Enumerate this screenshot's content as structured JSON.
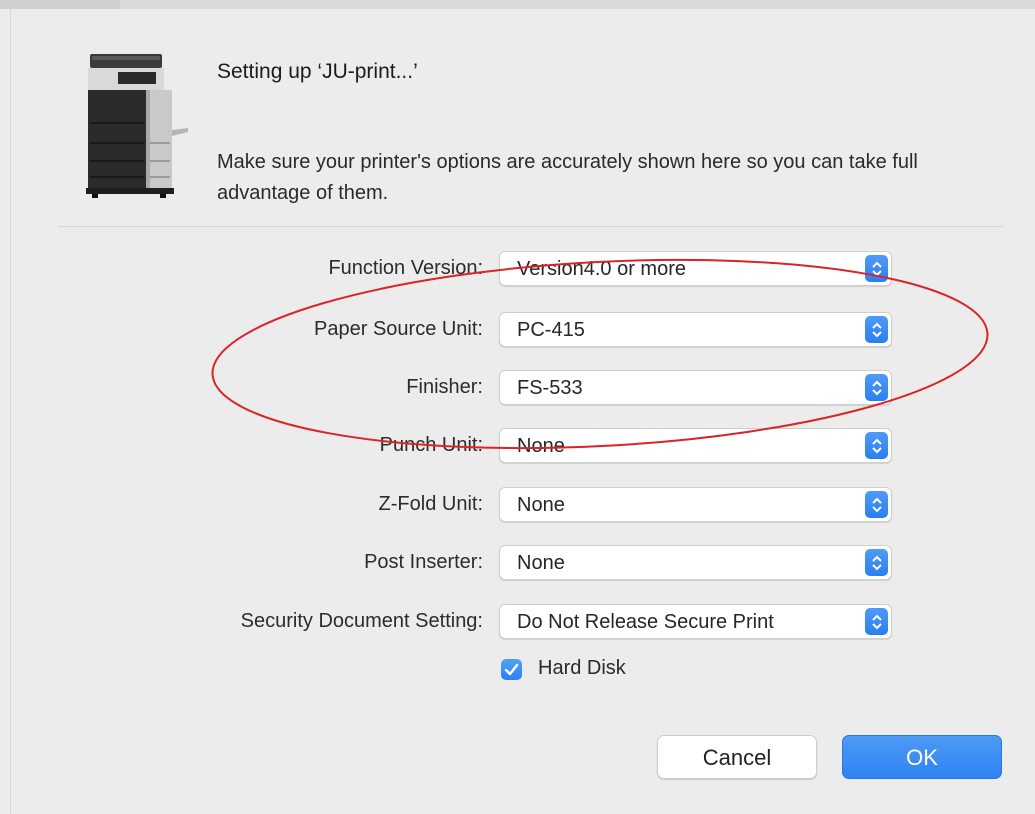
{
  "dialog": {
    "title": "Setting up ‘JU-print...’",
    "description": "Make sure your printer's options are accurately shown here so you can take full advantage of them.",
    "icon": "printer-icon"
  },
  "options": [
    {
      "label": "Function Version:",
      "value": "Version4.0 or more"
    },
    {
      "label": "Paper Source Unit:",
      "value": "PC-415"
    },
    {
      "label": "Finisher:",
      "value": "FS-533"
    },
    {
      "label": "Punch Unit:",
      "value": "None"
    },
    {
      "label": "Z-Fold Unit:",
      "value": "None"
    },
    {
      "label": "Post Inserter:",
      "value": "None"
    },
    {
      "label": "Security Document Setting:",
      "value": "Do Not Release Secure Print"
    }
  ],
  "hard_disk": {
    "label": "Hard Disk",
    "checked": true
  },
  "buttons": {
    "cancel": "Cancel",
    "ok": "OK"
  },
  "colors": {
    "accent": "#2f82f2",
    "annotation": "#d9242a"
  }
}
